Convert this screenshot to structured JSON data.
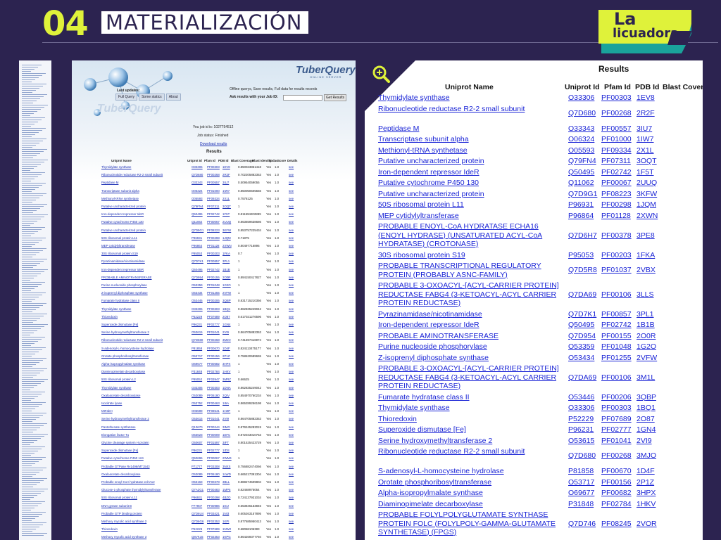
{
  "header": {
    "number": "04",
    "title": "MATERIALIZACIÓN"
  },
  "logo": {
    "line1": "La",
    "line2": "licuadora",
    "accent": "#dff23a",
    "teal": "#1aa39b"
  },
  "colors": {
    "background": "#2c2350",
    "link": "#1a24d6"
  },
  "middle": {
    "logo_text": "TuberQuery",
    "logo_sub": "ONLINE SERVER",
    "updates_label": "Last updates:",
    "tabs": [
      "Full Query",
      "Some statics",
      "About"
    ],
    "offline_note": "Offline querys, Save results, Full data for results records",
    "ask_label": "Ask results with your Job ID:",
    "get_button": "Get Results",
    "job_id": "You job id is: 1027754512",
    "job_status": "Job status: Finished",
    "download": "Download results",
    "results_label": "Results",
    "columns": [
      "Uniprot Name",
      "Uniprot Id",
      "Pfam Id",
      "PDB Id",
      "Blast Coverage",
      "Blast Identity",
      "Todas",
      "Score",
      "Details"
    ],
    "rows": [
      [
        "Thymidylate synthase",
        "O33306",
        "PF00303",
        "1EV8",
        "0.850023851418",
        "Yes",
        "1.0",
        "see"
      ],
      [
        "Ribonucleotide reductase R2-2 small subunit",
        "Q7D680",
        "PF00268",
        "2R2F",
        "0.702205882353",
        "Yes",
        "1.0",
        "see"
      ],
      [
        "Peptidase M",
        "O33343",
        "PF00557",
        "3IU7",
        "0.50954059055",
        "Yes",
        "1.0",
        "see"
      ],
      [
        "Transcriptase subunit alpha",
        "O06324",
        "PF01000",
        "1IW7",
        "0.850050505556",
        "Yes",
        "1.0",
        "see"
      ],
      [
        "Methionyl-tRNA synthetase",
        "O05593",
        "PF09334",
        "2X1L",
        "0.7578125",
        "Yes",
        "1.0",
        "see"
      ],
      [
        "Putative uncharacterized protein",
        "Q79FN4",
        "PF07311",
        "3OQT",
        "1",
        "Yes",
        "1.0",
        "see"
      ],
      [
        "Iron-dependent repressor IdeR",
        "Q50495",
        "PF02742",
        "1F5T",
        "0.811594202899",
        "Yes",
        "1.0",
        "see"
      ],
      [
        "Putative cytochrome P450 130",
        "Q11062",
        "PF00067",
        "2UUQ",
        "0.863659638686",
        "Yes",
        "1.0",
        "see"
      ],
      [
        "Putative uncharacterized protein",
        "Q7D9G1",
        "PF08223",
        "3KFW",
        "0.853757225434",
        "Yes",
        "1.0",
        "see"
      ],
      [
        "50S ribosomal protein L11",
        "P96931",
        "PF00298",
        "1JQM",
        "0.71875",
        "Yes",
        "1.0",
        "see"
      ],
      [
        "MEP cytidylyltransferase",
        "P96864",
        "PF01128",
        "2XWN",
        "0.80497716895",
        "Yes",
        "1.0",
        "see"
      ],
      [
        "30S ribosomal protein S19",
        "P95053",
        "PF00203",
        "1FKA",
        "0.7",
        "Yes",
        "1.0",
        "see"
      ],
      [
        "Pyrazinamidase/nicotinamidase",
        "Q7D7K1",
        "PF00857",
        "3PL1",
        "1",
        "Yes",
        "1.0",
        "see"
      ],
      [
        "Iron-dependent repressor IdeR",
        "Q50495",
        "PF02742",
        "1B1B",
        "1",
        "Yes",
        "1.0",
        "see"
      ],
      [
        "PROBABLE AMINOTRANSFERASE",
        "Q7D954",
        "PF00155",
        "2O0R",
        "0.894150417827",
        "Yes",
        "1.0",
        "see"
      ],
      [
        "Purine nucleoside phosphorylase",
        "O53359",
        "PF01048",
        "1G2O",
        "1",
        "Yes",
        "1.0",
        "see"
      ],
      [
        "Z-isoprenyl diphosphate synthase",
        "O53434",
        "PF01255",
        "2VFW",
        "1",
        "Yes",
        "1.0",
        "see"
      ],
      [
        "Fumarate hydratase class II",
        "O53446",
        "PF00206",
        "3QBP",
        "0.831715210356",
        "Yes",
        "1.0",
        "see"
      ],
      [
        "Thymidylate synthase",
        "O33306",
        "PF00303",
        "1BQ1",
        "0.862835249042",
        "Yes",
        "1.0",
        "see"
      ],
      [
        "Thioredoxin",
        "P52229",
        "PF07689",
        "2O87",
        "0.617021276596",
        "Yes",
        "1.0",
        "see"
      ],
      [
        "Superoxide dismutase [Fe]",
        "P96231",
        "PF02777",
        "1GN4",
        "1",
        "Yes",
        "1.0",
        "see"
      ],
      [
        "Serine hydroxymethyltransferase 2",
        "O53615",
        "PF01041",
        "2VI9",
        "0.864705882353",
        "Yes",
        "1.0",
        "see"
      ],
      [
        "Ribonucleotide reductase R2-2 small subunit",
        "Q7D680",
        "PF00268",
        "3MJO",
        "0.741697416974",
        "Yes",
        "1.0",
        "see"
      ],
      [
        "S-adenosyl-L-homocysteine hydrolase",
        "P81858",
        "PF00670",
        "1D4F",
        "0.824113475177",
        "Yes",
        "1.0",
        "see"
      ],
      [
        "Orotate phosphoribosyltransferase",
        "O53717",
        "PF00156",
        "2P1Z",
        "0.758620689655",
        "Yes",
        "1.0",
        "see"
      ],
      [
        "Alpha-isopropylmalate synthase",
        "O69677",
        "PF00682",
        "3HPX",
        "1",
        "Yes",
        "1.0",
        "see"
      ],
      [
        "Diaminopimelate decarboxylase",
        "P31848",
        "PF02784",
        "1HKV",
        "1",
        "Yes",
        "1.0",
        "see"
      ],
      [
        "50S ribosomal protein L2",
        "P95052",
        "PF03947",
        "3MRZ",
        "0.66625",
        "Yes",
        "1.0",
        "see"
      ],
      [
        "Thymidylate synthase",
        "O33306",
        "PF00303",
        "1DNA",
        "0.862835249042",
        "Yes",
        "1.0",
        "see"
      ],
      [
        "Oxaloacetate decarboxylase",
        "O53089",
        "PF06180",
        "2QIV",
        "0.854970760234",
        "Yes",
        "1.0",
        "see"
      ],
      [
        "Isocitrate lyase",
        "O53752",
        "PF00463",
        "1I6A",
        "0.865289256198",
        "Yes",
        "1.0",
        "see"
      ],
      [
        "MtFabH",
        "O06599",
        "PF08541",
        "1HZP",
        "1",
        "Yes",
        "1.0",
        "see"
      ],
      [
        "Serine hydroxymethyltransferase 2",
        "O53615",
        "PF01041",
        "2VI9",
        "0.864705882353",
        "Yes",
        "1.0",
        "see"
      ],
      [
        "Pantothenate synthetase",
        "Q10670",
        "PF00244",
        "3IMG",
        "0.879245283019",
        "Yes",
        "1.0",
        "see"
      ],
      [
        "Elongation factor Tu",
        "O53623",
        "PF00009",
        "1EFC",
        "0.872043010753",
        "Yes",
        "1.0",
        "see"
      ],
      [
        "Glycine cleavage system H protein",
        "O50607",
        "PF01597",
        "3IFT",
        "0.801525423729",
        "Yes",
        "1.0",
        "see"
      ],
      [
        "Superoxide dismutase [Fe]",
        "P96231",
        "PF02777",
        "1IDS",
        "1",
        "Yes",
        "1.0",
        "see"
      ],
      [
        "Putative cytochrome P450 124",
        "Q50696",
        "PF00067",
        "2WM4",
        "1",
        "Yes",
        "1.0",
        "see"
      ],
      [
        "Probable GTPase Rv1496/MT1543",
        "P71777",
        "PF03308",
        "3NXS",
        "0.756882474066",
        "Yes",
        "1.0",
        "see"
      ],
      [
        "Oxaloacetate decarboxylase",
        "O53089",
        "PF06180",
        "1LWD",
        "0.665217391304",
        "Yes",
        "1.0",
        "see"
      ],
      [
        "Probable enoyl-CoA hydratase echA12",
        "O53163",
        "PF00378",
        "3BLL",
        "0.888274509804",
        "Yes",
        "1.0",
        "see"
      ],
      [
        "Glucose-1-phosphate thymidylyltransferase",
        "Q7A2G1",
        "PF00483",
        "1MP5",
        "0.82468975054",
        "Yes",
        "1.0",
        "see"
      ],
      [
        "50S ribosomal protein L11",
        "P96931",
        "PF00298",
        "4BZO",
        "0.724137931034",
        "Yes",
        "1.0",
        "see"
      ],
      [
        "DNA gyrase subunit B",
        "P77907",
        "PF00986",
        "1KIJ",
        "0.653846153846",
        "Yes",
        "1.0",
        "see"
      ],
      [
        "Probable GTP binding protein",
        "Q7D6U4",
        "PF03421",
        "1NI3",
        "0.605263157895",
        "Yes",
        "1.0",
        "see"
      ],
      [
        "Methoxy mycolic acid synthase 2",
        "Q7D6G6",
        "PF02353",
        "1KPI",
        "0.877685950413",
        "Yes",
        "1.0",
        "see"
      ],
      [
        "Thioredoxin",
        "P52229",
        "PF07689",
        "1NW2",
        "0.68068106383",
        "Yes",
        "1.0",
        "see"
      ],
      [
        "Methoxy mycolic acid synthase 3",
        "Q8VK15",
        "PF02353",
        "1KPG",
        "0.864269377794",
        "Yes",
        "1.0",
        "see"
      ]
    ]
  },
  "results": {
    "title": "Results",
    "columns": {
      "name": "Uniprot Name",
      "uniprot_id": "Uniprot Id",
      "pfam_id": "Pfam Id",
      "pdb_id": "PDB Id",
      "blast": "Blast Cover"
    },
    "rows": [
      {
        "name": "Thymidylate synthase",
        "uid": "O33306",
        "pfam": "PF00303",
        "pdb": "1EV8"
      },
      {
        "name": "Ribonucleotide reductase R2-2 small subunit",
        "uid": "Q7D680",
        "pfam": "PF00268",
        "pdb": "2R2F"
      },
      {
        "name": "Peptidase M",
        "uid": "O33343",
        "pfam": "PF00557",
        "pdb": "3IU7"
      },
      {
        "name": "Transcriptase subunit alpha",
        "uid": "O06324",
        "pfam": "PF01000",
        "pdb": "1IW7"
      },
      {
        "name": "Methionyl-tRNA synthetase",
        "uid": "O05593",
        "pfam": "PF09334",
        "pdb": "2X1L"
      },
      {
        "name": "Putative uncharacterized protein",
        "uid": "Q79FN4",
        "pfam": "PF07311",
        "pdb": "3OQT"
      },
      {
        "name": "Iron-dependent repressor IdeR",
        "uid": "Q50495",
        "pfam": "PF02742",
        "pdb": "1F5T"
      },
      {
        "name": "Putative cytochrome P450 130",
        "uid": "Q11062",
        "pfam": "PF00067",
        "pdb": "2UUQ"
      },
      {
        "name": "Putative uncharacterized protein",
        "uid": "Q7D9G1",
        "pfam": "PF08223",
        "pdb": "3KFW"
      },
      {
        "name": "50S ribosomal protein L11",
        "uid": "P96931",
        "pfam": "PF00298",
        "pdb": "1JQM"
      },
      {
        "name": "MEP cytidylyltransferase",
        "uid": "P96864",
        "pfam": "PF01128",
        "pdb": "2XWN"
      },
      {
        "name": "PROBABLE ENOYL-CoA HYDRATASE ECHA16 (ENOYL HYDRASE) (UNSATURATED ACYL-CoA HYDRATASE) (CROTONASE)",
        "uid": "Q7D6H7",
        "pfam": "PF00378",
        "pdb": "3PE8"
      },
      {
        "name": "30S ribosomal protein S19",
        "uid": "P95053",
        "pfam": "PF00203",
        "pdb": "1FKA"
      },
      {
        "name": "PROBABLE TRANSCRIPTIONAL REGULATORY PROTEIN (PROBABLY ASNC-FAMILY)",
        "uid": "Q7D5R8",
        "pfam": "PF01037",
        "pdb": "2VBX"
      },
      {
        "name": "PROBABLE 3-OXOACYL-[ACYL-CARRIER PROTEIN] REDUCTASE FABG4 (3-KETOACYL-ACYL CARRIER PROTEIN REDUCTASE)",
        "uid": "Q7DA69",
        "pfam": "PF00106",
        "pdb": "3LLS"
      },
      {
        "name": "Pyrazinamidase/nicotinamidase",
        "uid": "Q7D7K1",
        "pfam": "PF00857",
        "pdb": "3PL1"
      },
      {
        "name": "Iron-dependent repressor IdeR",
        "uid": "Q50495",
        "pfam": "PF02742",
        "pdb": "1B1B"
      },
      {
        "name": "PROBABLE AMINOTRANSFERASE",
        "uid": "Q7D954",
        "pfam": "PF00155",
        "pdb": "2O0R"
      },
      {
        "name": "Purine nucleoside phosphorylase",
        "uid": "O53359",
        "pfam": "PF01048",
        "pdb": "1G2O"
      },
      {
        "name": "Z-isoprenyl diphosphate synthase",
        "uid": "O53434",
        "pfam": "PF01255",
        "pdb": "2VFW"
      },
      {
        "name": "PROBABLE 3-OXOACYL-[ACYL-CARRIER PROTEIN] REDUCTASE FABG4 (3-KETOACYL-ACYL CARRIER PROTEIN REDUCTASE)",
        "uid": "Q7DA69",
        "pfam": "PF00106",
        "pdb": "3M1L"
      },
      {
        "name": "Fumarate hydratase class II",
        "uid": "O53446",
        "pfam": "PF00206",
        "pdb": "3QBP"
      },
      {
        "name": "Thymidylate synthase",
        "uid": "O33306",
        "pfam": "PF00303",
        "pdb": "1BQ1"
      },
      {
        "name": "Thioredoxin",
        "uid": "P52229",
        "pfam": "PF07689",
        "pdb": "2O87"
      },
      {
        "name": "Superoxide dismutase [Fe]",
        "uid": "P96231",
        "pfam": "PF02777",
        "pdb": "1GN4"
      },
      {
        "name": "Serine hydroxymethyltransferase 2",
        "uid": "O53615",
        "pfam": "PF01041",
        "pdb": "2VI9"
      },
      {
        "name": "Ribonucleotide reductase R2-2 small subunit",
        "uid": "Q7D680",
        "pfam": "PF00268",
        "pdb": "3MJO"
      },
      {
        "name": "S-adenosyl-L-homocysteine hydrolase",
        "uid": "P81858",
        "pfam": "PF00670",
        "pdb": "1D4F"
      },
      {
        "name": "Orotate phosphoribosyltransferase",
        "uid": "O53717",
        "pfam": "PF00156",
        "pdb": "2P1Z"
      },
      {
        "name": "Alpha-isopropylmalate synthase",
        "uid": "O69677",
        "pfam": "PF00682",
        "pdb": "3HPX"
      },
      {
        "name": "Diaminopimelate decarboxylase",
        "uid": "P31848",
        "pfam": "PF02784",
        "pdb": "1HKV"
      },
      {
        "name": "PROBABLE FOLYLPOLYGLUTAMATE SYNTHASE PROTEIN FOLC (FOLYLPOLY-GAMMA-GLUTAMATE SYNTHETASE) (FPGS)",
        "uid": "Q7D746",
        "pfam": "PF08245",
        "pdb": "2VOR"
      },
      {
        "name": "50S ribosomal protein L2",
        "uid": "P95052",
        "pfam": "PF03947",
        "pdb": "3MRZ"
      },
      {
        "name": "Thymidylate synthase",
        "uid": "O33306",
        "pfam": "PF00303",
        "pdb": "1DNA"
      }
    ]
  }
}
